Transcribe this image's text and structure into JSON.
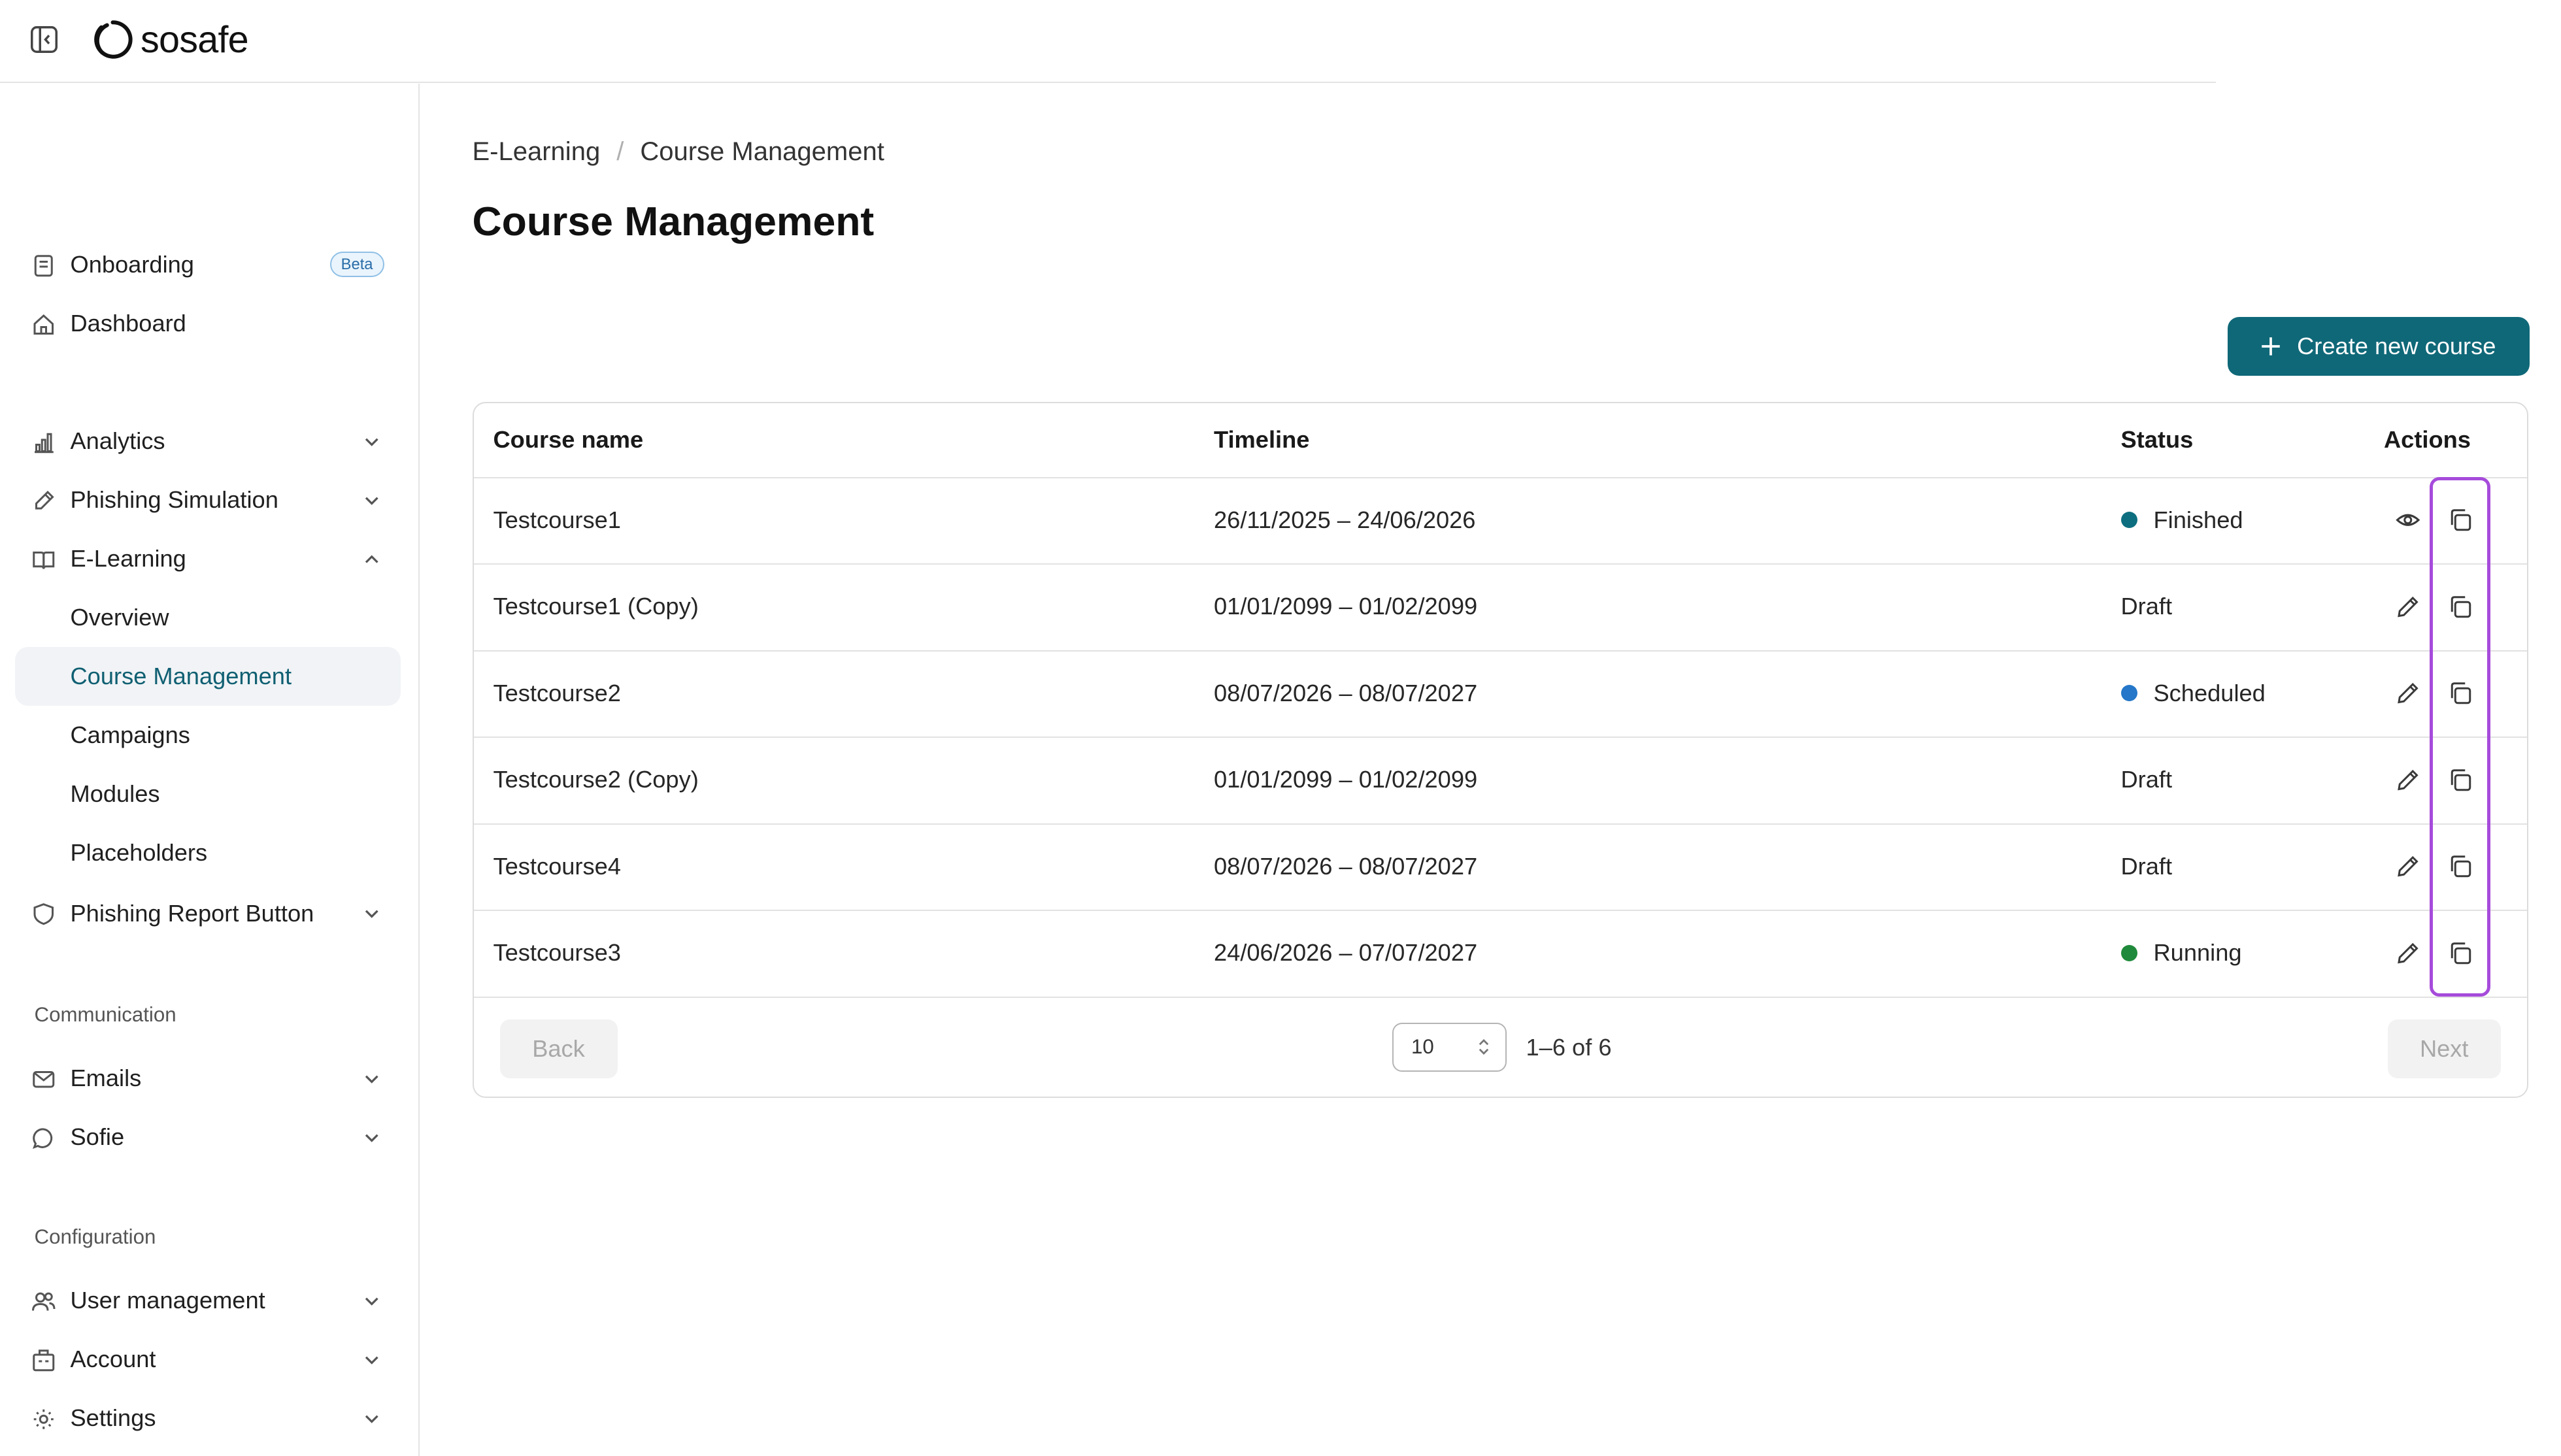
{
  "header": {
    "logo_text": "sosafe"
  },
  "sidebar": {
    "onboarding": {
      "label": "Onboarding",
      "badge": "Beta"
    },
    "dashboard": {
      "label": "Dashboard"
    },
    "analytics": {
      "label": "Analytics"
    },
    "phishing_simulation": {
      "label": "Phishing Simulation"
    },
    "elearning": {
      "label": "E-Learning",
      "children": [
        "Overview",
        "Course Management",
        "Campaigns",
        "Modules",
        "Placeholders"
      ],
      "active_child": "Course Management"
    },
    "phishing_report_button": {
      "label": "Phishing Report Button"
    },
    "communication_section": "Communication",
    "emails": {
      "label": "Emails"
    },
    "sofie": {
      "label": "Sofie"
    },
    "configuration_section": "Configuration",
    "user_management": {
      "label": "User management"
    },
    "account": {
      "label": "Account"
    },
    "settings": {
      "label": "Settings"
    }
  },
  "breadcrumb": {
    "parent": "E-Learning",
    "separator": "/",
    "current": "Course Management"
  },
  "page": {
    "title": "Course Management"
  },
  "actions": {
    "create_label": "Create new course"
  },
  "table": {
    "columns": {
      "name": "Course name",
      "timeline": "Timeline",
      "status": "Status",
      "actions": "Actions"
    },
    "rows": [
      {
        "name": "Testcourse1",
        "timeline": "26/11/2025 – 24/06/2026",
        "status": "Finished",
        "status_color": "#0d6e7f",
        "primary_action": "view"
      },
      {
        "name": "Testcourse1 (Copy)",
        "timeline": "01/01/2099 – 01/02/2099",
        "status": "Draft",
        "status_color": "",
        "primary_action": "edit"
      },
      {
        "name": "Testcourse2",
        "timeline": "08/07/2026 – 08/07/2027",
        "status": "Scheduled",
        "status_color": "#2477c9",
        "primary_action": "edit"
      },
      {
        "name": "Testcourse2 (Copy)",
        "timeline": "01/01/2099 – 01/02/2099",
        "status": "Draft",
        "status_color": "",
        "primary_action": "edit"
      },
      {
        "name": "Testcourse4",
        "timeline": "08/07/2026 – 08/07/2027",
        "status": "Draft",
        "status_color": "",
        "primary_action": "edit"
      },
      {
        "name": "Testcourse3",
        "timeline": "24/06/2026 – 07/07/2027",
        "status": "Running",
        "status_color": "#1f8a3b",
        "primary_action": "edit"
      }
    ]
  },
  "pagination": {
    "back_label": "Back",
    "next_label": "Next",
    "page_size": "10",
    "range": "1–6 of 6"
  },
  "colors": {
    "accent": "#0f6878",
    "active_text": "#0f5f72",
    "highlight": "#a64bdb"
  }
}
